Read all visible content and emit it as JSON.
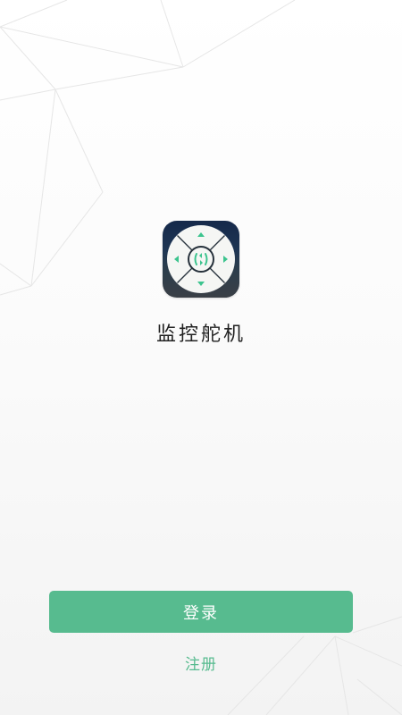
{
  "app": {
    "name": "监控舵机",
    "icon": "remote-dpad-icon"
  },
  "actions": {
    "login_label": "登录",
    "register_label": "注册"
  },
  "colors": {
    "accent": "#57bb8f",
    "icon_bg_top": "#15294a",
    "icon_bg_bottom": "#3a3f46",
    "icon_pad": "#f5f6f4",
    "icon_glyph": "#3cc48e",
    "text": "#222222"
  }
}
